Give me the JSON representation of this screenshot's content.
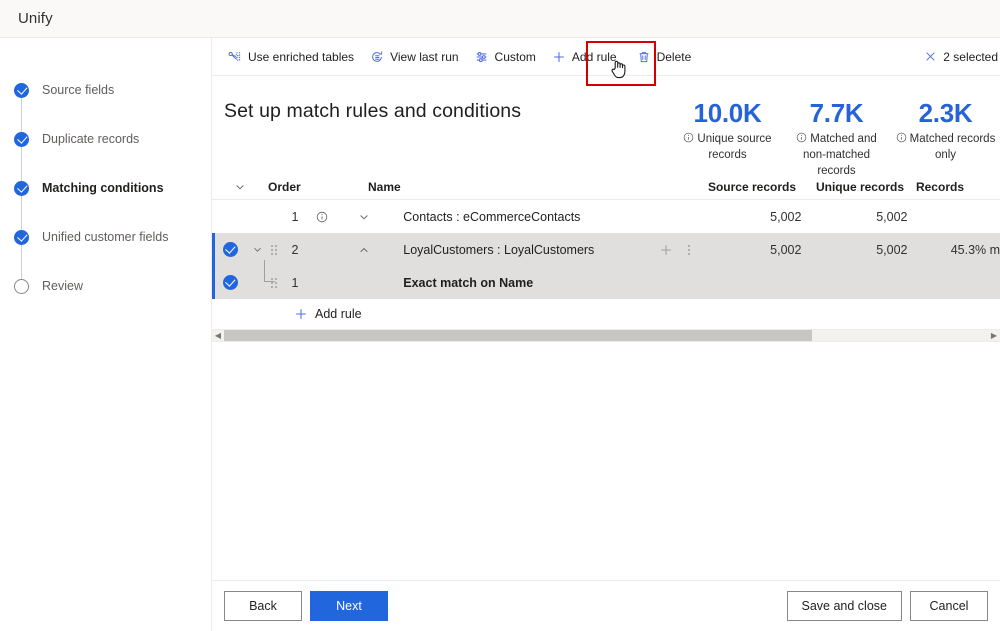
{
  "topbar": {
    "title": "Unify"
  },
  "sidebar": {
    "steps": [
      {
        "label": "Source fields",
        "state": "done"
      },
      {
        "label": "Duplicate records",
        "state": "done"
      },
      {
        "label": "Matching conditions",
        "state": "current"
      },
      {
        "label": "Unified customer fields",
        "state": "done"
      },
      {
        "label": "Review",
        "state": "todo"
      }
    ]
  },
  "commandbar": {
    "items": [
      {
        "label": "Use enriched tables",
        "icon": "enriched-tables-icon"
      },
      {
        "label": "View last run",
        "icon": "history-icon"
      },
      {
        "label": "Custom",
        "icon": "sliders-icon"
      },
      {
        "label": "Add rule",
        "icon": "plus-icon"
      },
      {
        "label": "Delete",
        "icon": "trash-icon"
      }
    ],
    "selection_label": "2 selected",
    "selection_icon": "close-icon",
    "highlighted_item": "Delete"
  },
  "page": {
    "title": "Set up match rules and conditions"
  },
  "kpis": [
    {
      "value": "10.0K",
      "label_line1": "Unique source",
      "label_line2": "records"
    },
    {
      "value": "7.7K",
      "label_line1": "Matched and",
      "label_line2": "non-matched records"
    },
    {
      "value": "2.3K",
      "label_line1": "Matched records",
      "label_line2": "only"
    }
  ],
  "table": {
    "headers": {
      "order": "Order",
      "name": "Name",
      "source_records": "Source records",
      "unique_records": "Unique records",
      "records": "Records"
    },
    "rows": [
      {
        "type": "rule",
        "selected": false,
        "order": "1",
        "name": "Contacts : eCommerceContacts",
        "source_records": "5,002",
        "unique_records": "5,002",
        "records": "",
        "expanded": false
      },
      {
        "type": "rule",
        "selected": true,
        "order": "2",
        "name": "LoyalCustomers : LoyalCustomers",
        "source_records": "5,002",
        "unique_records": "5,002",
        "records": "45.3% m",
        "expanded": true
      },
      {
        "type": "condition",
        "selected": true,
        "order": "1",
        "name": "Exact match on Name",
        "source_records": "",
        "unique_records": "",
        "records": ""
      }
    ],
    "add_rule_label": "Add rule"
  },
  "footer": {
    "back": "Back",
    "next": "Next",
    "save_and_close": "Save and close",
    "cancel": "Cancel"
  },
  "colors": {
    "accent": "#2266dd",
    "icon_accent": "#4f6bed",
    "kpi_value": "#2763d8",
    "highlight_box": "#d40000",
    "selected_row": "#e1dfdd"
  }
}
